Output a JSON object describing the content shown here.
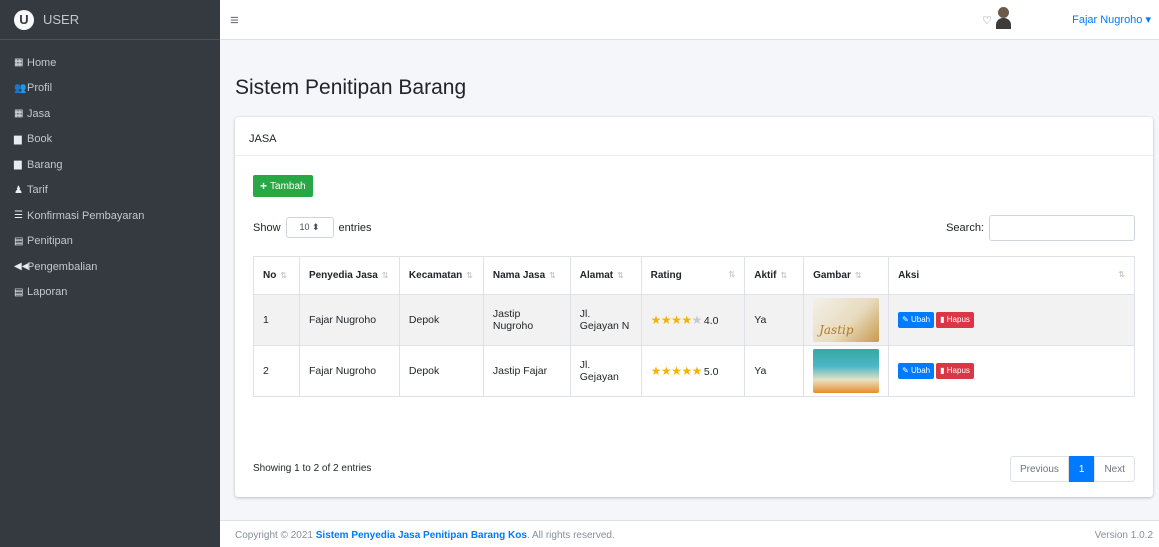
{
  "brand": {
    "logo_letter": "U",
    "title": "USER"
  },
  "sidebar": {
    "items": [
      {
        "icon": "▦",
        "icon_name": "home-icon",
        "label": "Home"
      },
      {
        "icon": "👥",
        "icon_name": "profile-icon",
        "label": "Profil"
      },
      {
        "icon": "▦",
        "icon_name": "jasa-icon",
        "label": "Jasa"
      },
      {
        "icon": "▆",
        "icon_name": "book-icon",
        "label": "Book"
      },
      {
        "icon": "▆",
        "icon_name": "barang-icon",
        "label": "Barang"
      },
      {
        "icon": "♟",
        "icon_name": "tarif-icon",
        "label": "Tarif"
      },
      {
        "icon": "☰",
        "icon_name": "konfirmasi-icon",
        "label": "Konfirmasi Pembayaran"
      },
      {
        "icon": "▤",
        "icon_name": "penitipan-icon",
        "label": "Penitipan"
      },
      {
        "icon": "◀◀",
        "icon_name": "pengembalian-icon",
        "label": "Pengembalian"
      },
      {
        "icon": "▤",
        "icon_name": "laporan-icon",
        "label": "Laporan"
      }
    ]
  },
  "topbar": {
    "menu_icon": "≡",
    "bell_icon": "♫",
    "user_name": "Fajar Nugroho ▾"
  },
  "page": {
    "title": "Sistem Penitipan Barang"
  },
  "card": {
    "header": "JASA",
    "add_button": "Tambah",
    "add_icon": "+"
  },
  "datatable": {
    "show_label": "Show",
    "entries_value": "10 ⬍",
    "entries_label": "entries",
    "search_label": "Search:",
    "search_value": "",
    "sort_icon": "⇅",
    "columns": [
      "No",
      "Penyedia Jasa",
      "Kecamatan",
      "Nama Jasa",
      "Alamat",
      "Rating",
      "Aktif",
      "Gambar",
      "Aksi"
    ],
    "rows": [
      {
        "no": "1",
        "penyedia": "Fajar Nugroho",
        "kecamatan": "Depok",
        "nama_jasa": "Jastip Nugroho",
        "alamat": "Jl. Gejayan N",
        "stars_filled": 4,
        "stars_empty": 1,
        "rating": "4.0",
        "aktif": "Ya",
        "gambar_text": "Jastip"
      },
      {
        "no": "2",
        "penyedia": "Fajar Nugroho",
        "kecamatan": "Depok",
        "nama_jasa": "Jastip Fajar",
        "alamat": "Jl. Gejayan",
        "stars_filled": 5,
        "stars_empty": 0,
        "rating": "5.0",
        "aktif": "Ya",
        "gambar_text": ""
      }
    ],
    "edit_label": "✎ Ubah",
    "delete_label": "▮ Hapus",
    "info": "Showing 1 to 2 of 2 entries",
    "pagination": {
      "previous": "Previous",
      "current": "1",
      "next": "Next"
    }
  },
  "footer": {
    "prefix": "Copyright © 2021 ",
    "brand": "Sistem Penyedia Jasa Penitipan Barang Kos",
    "suffix": ". All rights reserved.",
    "version": "Version 1.0.2"
  },
  "colors": {
    "sidebar": "#343a40",
    "primary": "#007bff",
    "success": "#28a745",
    "danger": "#dc3545",
    "star": "#f5b301"
  }
}
